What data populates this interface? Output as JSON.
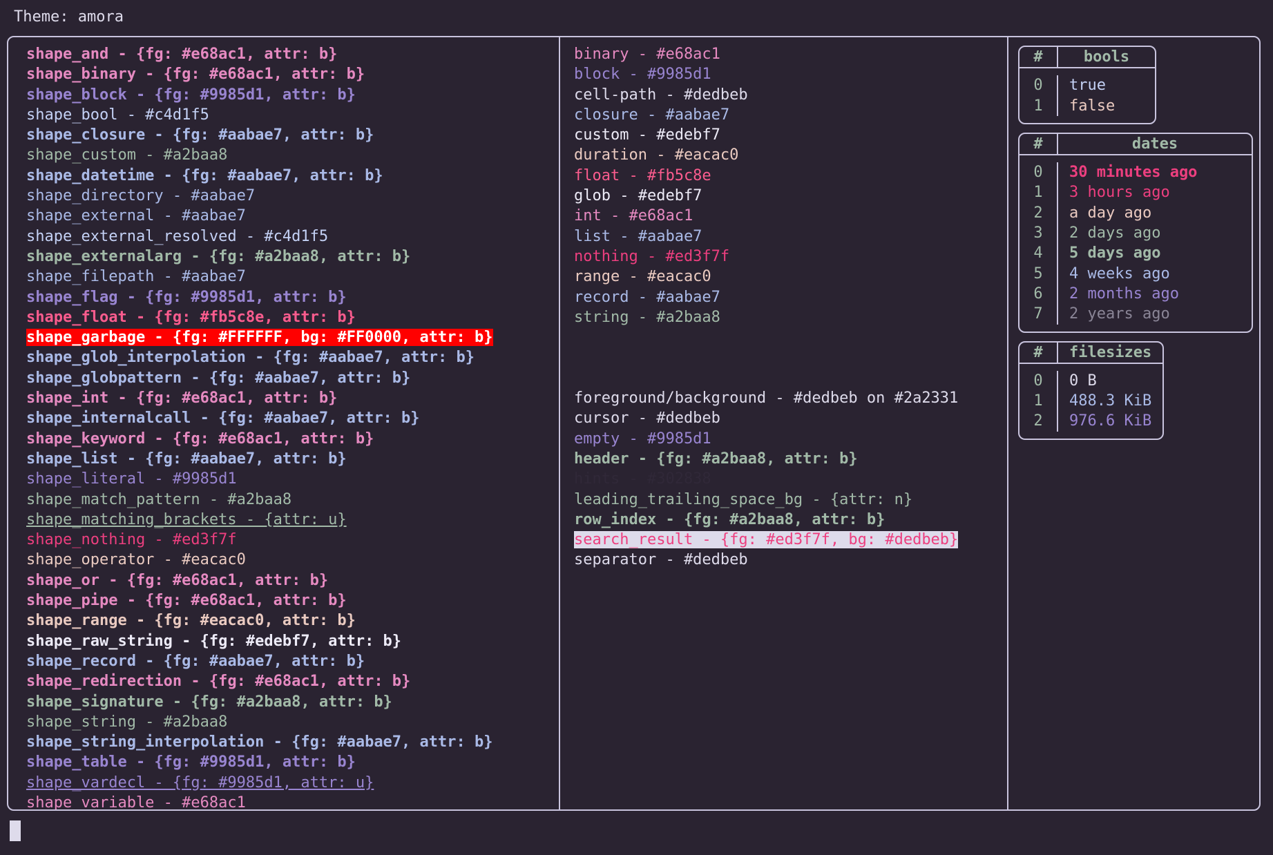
{
  "header": {
    "title": "Theme: amora"
  },
  "theme_colors": {
    "background": "#2a2331",
    "foreground": "#dedbeb",
    "pink": "#e68ac1",
    "purple": "#9985d1",
    "lavender": "#c4d1f5",
    "blue": "#aabae7",
    "green": "#a2baa8",
    "rose": "#fb5c8e",
    "red": "#ed3f7f",
    "peach": "#eacac0",
    "white": "#edebf7",
    "hint": "#302838",
    "border": "#c9c4de",
    "garbage_bg": "#ff0000",
    "garbage_fg": "#ffffff"
  },
  "shapes": [
    {
      "text": "shape_and - {fg: #e68ac1, attr: b}",
      "color": "c-pink",
      "bold": true
    },
    {
      "text": "shape_binary - {fg: #e68ac1, attr: b}",
      "color": "c-pink",
      "bold": true
    },
    {
      "text": "shape_block - {fg: #9985d1, attr: b}",
      "color": "c-purple",
      "bold": true
    },
    {
      "text": "shape_bool - #c4d1f5",
      "color": "c-lav",
      "bold": false
    },
    {
      "text": "shape_closure - {fg: #aabae7, attr: b}",
      "color": "c-blue",
      "bold": true
    },
    {
      "text": "shape_custom - #a2baa8",
      "color": "c-green",
      "bold": false
    },
    {
      "text": "shape_datetime - {fg: #aabae7, attr: b}",
      "color": "c-blue",
      "bold": true
    },
    {
      "text": "shape_directory - #aabae7",
      "color": "c-blue",
      "bold": false
    },
    {
      "text": "shape_external - #aabae7",
      "color": "c-blue",
      "bold": false
    },
    {
      "text": "shape_external_resolved - #c4d1f5",
      "color": "c-lav",
      "bold": false
    },
    {
      "text": "shape_externalarg - {fg: #a2baa8, attr: b}",
      "color": "c-green",
      "bold": true
    },
    {
      "text": "shape_filepath - #aabae7",
      "color": "c-blue",
      "bold": false
    },
    {
      "text": "shape_flag - {fg: #9985d1, attr: b}",
      "color": "c-purple",
      "bold": true
    },
    {
      "text": "shape_float - {fg: #fb5c8e, attr: b}",
      "color": "c-rose",
      "bold": true
    },
    {
      "text": "shape_garbage - {fg: #FFFFFF, bg: #FF0000, attr: b}",
      "color": "hl-red",
      "bold": true,
      "highlight": "red"
    },
    {
      "text": "shape_glob_interpolation - {fg: #aabae7, attr: b}",
      "color": "c-blue",
      "bold": true
    },
    {
      "text": "shape_globpattern - {fg: #aabae7, attr: b}",
      "color": "c-blue",
      "bold": true
    },
    {
      "text": "shape_int - {fg: #e68ac1, attr: b}",
      "color": "c-pink",
      "bold": true
    },
    {
      "text": "shape_internalcall - {fg: #aabae7, attr: b}",
      "color": "c-blue",
      "bold": true
    },
    {
      "text": "shape_keyword - {fg: #e68ac1, attr: b}",
      "color": "c-pink",
      "bold": true
    },
    {
      "text": "shape_list - {fg: #aabae7, attr: b}",
      "color": "c-blue",
      "bold": true
    },
    {
      "text": "shape_literal - #9985d1",
      "color": "c-purple",
      "bold": false
    },
    {
      "text": "shape_match_pattern - #a2baa8",
      "color": "c-green",
      "bold": false
    },
    {
      "text": "shape_matching_brackets - {attr: u}",
      "color": "c-green",
      "bold": false,
      "underline": true
    },
    {
      "text": "shape_nothing - #ed3f7f",
      "color": "c-red",
      "bold": false
    },
    {
      "text": "shape_operator - #eacac0",
      "color": "c-peach",
      "bold": false
    },
    {
      "text": "shape_or - {fg: #e68ac1, attr: b}",
      "color": "c-pink",
      "bold": true
    },
    {
      "text": "shape_pipe - {fg: #e68ac1, attr: b}",
      "color": "c-pink",
      "bold": true
    },
    {
      "text": "shape_range - {fg: #eacac0, attr: b}",
      "color": "c-peach",
      "bold": true
    },
    {
      "text": "shape_raw_string - {fg: #edebf7, attr: b}",
      "color": "c-white",
      "bold": true
    },
    {
      "text": "shape_record - {fg: #aabae7, attr: b}",
      "color": "c-blue",
      "bold": true
    },
    {
      "text": "shape_redirection - {fg: #e68ac1, attr: b}",
      "color": "c-pink",
      "bold": true
    },
    {
      "text": "shape_signature - {fg: #a2baa8, attr: b}",
      "color": "c-green",
      "bold": true
    },
    {
      "text": "shape_string - #a2baa8",
      "color": "c-green",
      "bold": false
    },
    {
      "text": "shape_string_interpolation - {fg: #aabae7, attr: b}",
      "color": "c-blue",
      "bold": true
    },
    {
      "text": "shape_table - {fg: #9985d1, attr: b}",
      "color": "c-purple",
      "bold": true
    },
    {
      "text": "shape_vardecl - {fg: #9985d1, attr: u}",
      "color": "c-purple",
      "bold": false,
      "underline": true
    },
    {
      "text": "shape_variable - #e68ac1",
      "color": "c-pink",
      "bold": false
    }
  ],
  "types": [
    {
      "text": "binary - #e68ac1",
      "color": "c-pink",
      "bold": false
    },
    {
      "text": "block - #9985d1",
      "color": "c-purple",
      "bold": false
    },
    {
      "text": "cell-path - #dedbeb",
      "color": "c-fg",
      "bold": false
    },
    {
      "text": "closure - #aabae7",
      "color": "c-blue",
      "bold": false
    },
    {
      "text": "custom - #edebf7",
      "color": "c-white",
      "bold": false
    },
    {
      "text": "duration - #eacac0",
      "color": "c-peach",
      "bold": false
    },
    {
      "text": "float - #fb5c8e",
      "color": "c-rose",
      "bold": false
    },
    {
      "text": "glob - #edebf7",
      "color": "c-white",
      "bold": false
    },
    {
      "text": "int - #e68ac1",
      "color": "c-pink",
      "bold": false
    },
    {
      "text": "list - #aabae7",
      "color": "c-blue",
      "bold": false
    },
    {
      "text": "nothing - #ed3f7f",
      "color": "c-red",
      "bold": false
    },
    {
      "text": "range - #eacac0",
      "color": "c-peach",
      "bold": false
    },
    {
      "text": "record - #aabae7",
      "color": "c-blue",
      "bold": false
    },
    {
      "text": "string - #a2baa8",
      "color": "c-green",
      "bold": false
    }
  ],
  "ui_elements": [
    {
      "text": "foreground/background - #dedbeb on #2a2331",
      "color": "c-fg",
      "bold": false
    },
    {
      "text": "cursor - #dedbeb",
      "color": "c-fg",
      "bold": false
    },
    {
      "text": "empty - #9985d1",
      "color": "c-purple",
      "bold": false
    },
    {
      "text": "header - {fg: #a2baa8, attr: b}",
      "color": "c-green",
      "bold": true
    },
    {
      "text": "hints - #302838",
      "color": "c-dim",
      "bold": false
    },
    {
      "text": "leading_trailing_space_bg - {attr: n}",
      "color": "c-green",
      "bold": false
    },
    {
      "text": "row_index - {fg: #a2baa8, attr: b}",
      "color": "c-green",
      "bold": true
    },
    {
      "text": "search_result - {fg: #ed3f7f, bg: #dedbeb}",
      "color": "hl-search",
      "bold": false,
      "highlight": "search"
    },
    {
      "text": "separator - #dedbeb",
      "color": "c-fg",
      "bold": false
    }
  ],
  "tables": [
    {
      "name": "bools",
      "columns": [
        "#",
        "bools"
      ],
      "rows": [
        {
          "index": "0",
          "value": "true",
          "color": "c-lav",
          "bold": false
        },
        {
          "index": "1",
          "value": "false",
          "color": "c-peach",
          "bold": false
        }
      ]
    },
    {
      "name": "dates",
      "columns": [
        "#",
        "dates"
      ],
      "rows": [
        {
          "index": "0",
          "value": "30 minutes ago",
          "color": "c-red",
          "bold": true
        },
        {
          "index": "1",
          "value": "3 hours ago",
          "color": "c-red",
          "bold": false
        },
        {
          "index": "2",
          "value": "a day ago",
          "color": "c-peach",
          "bold": false
        },
        {
          "index": "3",
          "value": "2 days ago",
          "color": "c-green",
          "bold": false
        },
        {
          "index": "4",
          "value": "5 days ago",
          "color": "c-green",
          "bold": true
        },
        {
          "index": "5",
          "value": "4 weeks ago",
          "color": "c-blue",
          "bold": false
        },
        {
          "index": "6",
          "value": "2 months ago",
          "color": "c-purple",
          "bold": false
        },
        {
          "index": "7",
          "value": "2 years ago",
          "color": "c-gray",
          "bold": false
        }
      ]
    },
    {
      "name": "filesizes",
      "columns": [
        "#",
        "filesizes"
      ],
      "rows": [
        {
          "index": "0",
          "value": "0 B",
          "color": "c-fg",
          "bold": false
        },
        {
          "index": "1",
          "value": "488.3 KiB",
          "color": "c-blue",
          "bold": false
        },
        {
          "index": "2",
          "value": "976.6 KiB",
          "color": "c-purple",
          "bold": false
        }
      ]
    }
  ],
  "prompt": {
    "cursor": "block-cursor"
  }
}
